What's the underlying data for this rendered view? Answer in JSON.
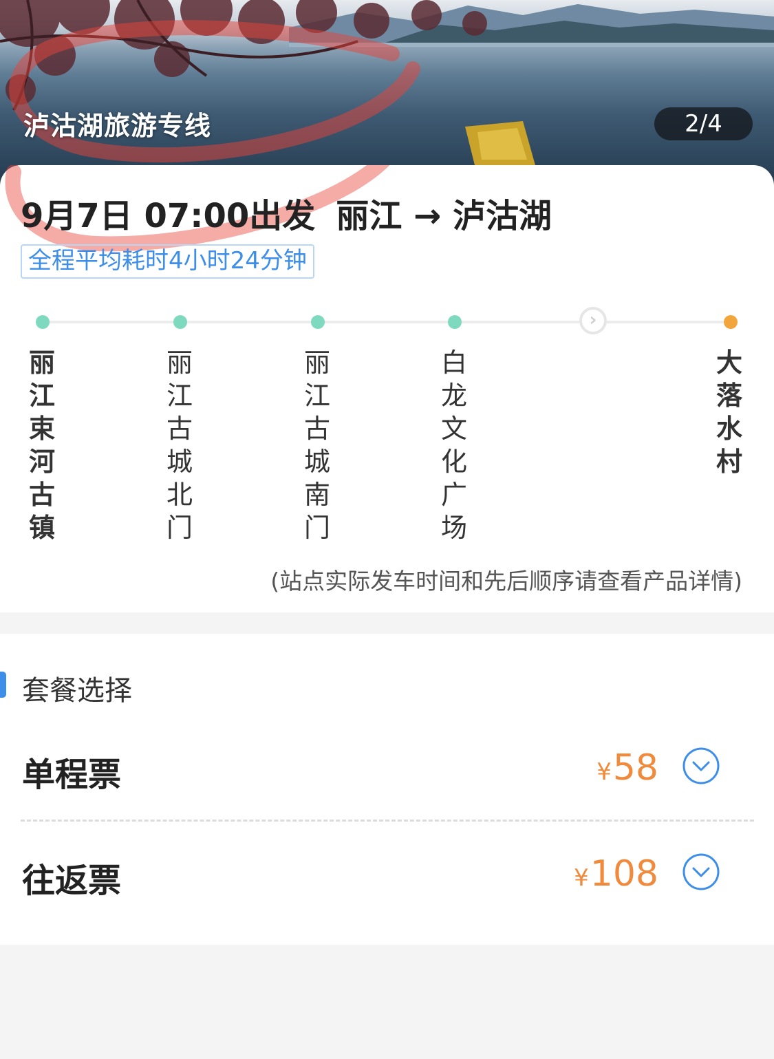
{
  "hero": {
    "title": "泸沽湖旅游专线",
    "counter": "2/4"
  },
  "trip": {
    "date_time": "9月7日 07:00出发",
    "route": "丽江 → 泸沽湖",
    "duration": "全程平均耗时4小时24分钟",
    "stops": [
      {
        "name": "丽江束河古镇"
      },
      {
        "name": "丽江古城北门"
      },
      {
        "name": "丽江古城南门"
      },
      {
        "name": "白龙文化广场"
      },
      {
        "name": "大落水村"
      }
    ],
    "note": "(站点实际发车时间和先后顺序请查看产品详情)"
  },
  "packages": {
    "title": "套餐选择",
    "items": [
      {
        "name": "单程票",
        "currency": "¥",
        "price": "58"
      },
      {
        "name": "往返票",
        "currency": "¥",
        "price": "108"
      }
    ]
  },
  "colors": {
    "accent_blue": "#3d8ee8",
    "price_orange": "#f08a3c",
    "stop_green": "#7ed9bf",
    "stop_orange": "#f1a53c",
    "annotation_red": "#e8443a"
  }
}
